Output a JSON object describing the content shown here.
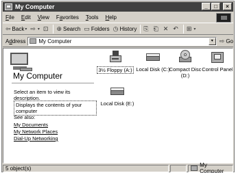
{
  "window": {
    "title": "My Computer"
  },
  "window_buttons": {
    "minimize": "_",
    "maximize": "□",
    "close": "×"
  },
  "menu": [
    {
      "underline": "F",
      "rest": "ile"
    },
    {
      "underline": "E",
      "rest": "dit"
    },
    {
      "underline": "V",
      "rest": "iew"
    },
    {
      "pre": "F",
      "underline": "a",
      "rest": "vorites"
    },
    {
      "underline": "T",
      "rest": "ools"
    },
    {
      "underline": "H",
      "rest": "elp"
    }
  ],
  "toolbar": {
    "back_label": "Back",
    "back_icon": "⇦",
    "forward_icon": "⇨",
    "up_icon": "⊡",
    "search_label": "Search",
    "search_icon": "⊕",
    "folders_label": "Folders",
    "folders_icon": "▭",
    "history_label": "History",
    "history_icon": "◷",
    "move_to_icon": "⎘",
    "copy_to_icon": "⎗",
    "delete_icon": "✕",
    "undo_icon": "↶",
    "views_icon": "⊞",
    "dropdown_arrow": "▾"
  },
  "address": {
    "label_underline": "d",
    "label_pre": "A",
    "label_post": "dress",
    "value": "My Computer",
    "go_label": "Go",
    "go_icon": "⇨",
    "dropdown_arrow": "▾"
  },
  "left_pane": {
    "title": "My Computer",
    "description": "Select an item to view its description.",
    "description2": "Displays the contents of your computer",
    "see_also": "See also:",
    "links": [
      "My Documents",
      "My Network Places",
      "Dial-Up Networking"
    ]
  },
  "drives": [
    {
      "label": "3½ Floppy (A:)",
      "icon": "floppy-drive-icon"
    },
    {
      "label": "Local Disk (C:)",
      "icon": "hard-disk-icon"
    },
    {
      "label": "Compact Disc",
      "label2": "(D:)",
      "icon": "cd-drive-icon"
    },
    {
      "label": "Control Panel",
      "icon": "control-panel-icon"
    },
    {
      "label": "Local Disk (E:)",
      "icon": "hard-disk-icon"
    }
  ],
  "status": {
    "objects": "5 object(s)",
    "zone": "My Computer"
  }
}
